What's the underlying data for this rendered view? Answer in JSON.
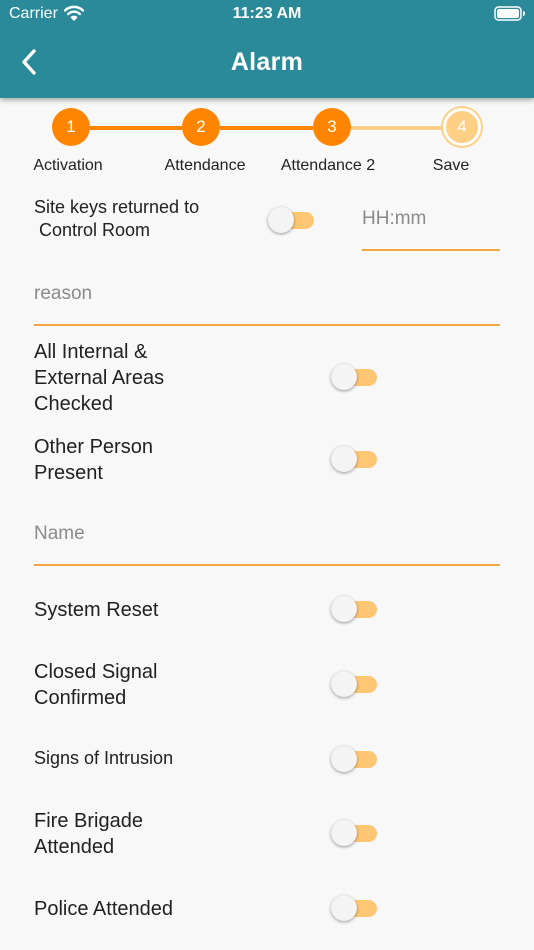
{
  "status_bar": {
    "carrier": "Carrier",
    "time": "11:23 AM"
  },
  "app_bar": {
    "title": "Alarm",
    "back_icon": "chevron-left-icon"
  },
  "stepper": {
    "steps": [
      {
        "number": "1",
        "label": "Activation",
        "state": "complete"
      },
      {
        "number": "2",
        "label": "Attendance",
        "state": "complete"
      },
      {
        "number": "3",
        "label": "Attendance 2",
        "state": "complete"
      },
      {
        "number": "4",
        "label": "Save",
        "state": "current"
      }
    ],
    "colors": {
      "active": "#ff8500",
      "pending": "#ffcf86"
    }
  },
  "form": {
    "site_keys": {
      "label_line1": "Site keys returned to",
      "label_line2": " Control Room",
      "checked": false
    },
    "time_input": {
      "placeholder": "HH:mm",
      "value": ""
    },
    "reason_input": {
      "placeholder": "reason",
      "value": ""
    },
    "areas_checked": {
      "label_line1": "All Internal &",
      "label_line2": "External Areas",
      "label_line3": "Checked",
      "checked": false
    },
    "other_person": {
      "label_line1": "Other Person",
      "label_line2": "Present",
      "checked": false
    },
    "name_input": {
      "placeholder": "Name",
      "value": ""
    },
    "system_reset": {
      "label": "System Reset",
      "checked": false
    },
    "closed_signal": {
      "label_line1": "Closed Signal",
      "label_line2": "Confirmed",
      "checked": false
    },
    "signs_of_intrusion": {
      "label": "Signs of Intrusion",
      "checked": false
    },
    "fire_brigade": {
      "label_line1": "Fire Brigade",
      "label_line2": "Attended",
      "checked": false
    },
    "police_attended": {
      "label": "Police Attended",
      "checked": false
    }
  },
  "colors": {
    "app_bar": "#2a8a99",
    "accent": "#ff8500",
    "switch_track": "#ffc774",
    "underline": "#f4a640",
    "background": "#f8f8f8"
  }
}
